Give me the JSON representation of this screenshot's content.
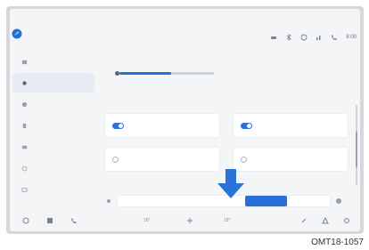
{
  "status_bar": {
    "icons": [
      "car-icon",
      "bluetooth-icon",
      "wifi-icon",
      "signal-icon",
      "phone-icon"
    ],
    "clock": "8:00"
  },
  "sidebar": {
    "items": [
      {
        "label": "",
        "icon": "home-icon"
      },
      {
        "label": "",
        "icon": "light-icon",
        "active": true
      },
      {
        "label": "",
        "icon": "door-icon"
      },
      {
        "label": "",
        "icon": "seat-icon"
      },
      {
        "label": "",
        "icon": "mirror-icon"
      },
      {
        "label": "",
        "icon": "settings-icon"
      },
      {
        "label": "",
        "icon": "display-icon"
      }
    ]
  },
  "main": {
    "brightness": {
      "label": "",
      "level": 0.55
    },
    "section_title": "",
    "cards": [
      {
        "label": "",
        "meta": "",
        "control": "toggle"
      },
      {
        "label": "",
        "meta": "",
        "control": "toggle"
      },
      {
        "label": "",
        "meta": "",
        "control": "radio"
      },
      {
        "label": "",
        "meta": "",
        "control": "radio"
      }
    ],
    "slider_title": "",
    "segment": {
      "cells": [
        "",
        "",
        "",
        "",
        ""
      ],
      "selected_index": 3
    }
  },
  "bottom_bar": {
    "left_icons": [
      "car-icon",
      "grid-icon",
      "phone-icon"
    ],
    "temp_left": "16°",
    "temp_right": "16°"
  },
  "caption": "OMT18-1057",
  "colors": {
    "accent": "#2a6fd6",
    "arrow": "#2a73d8"
  }
}
